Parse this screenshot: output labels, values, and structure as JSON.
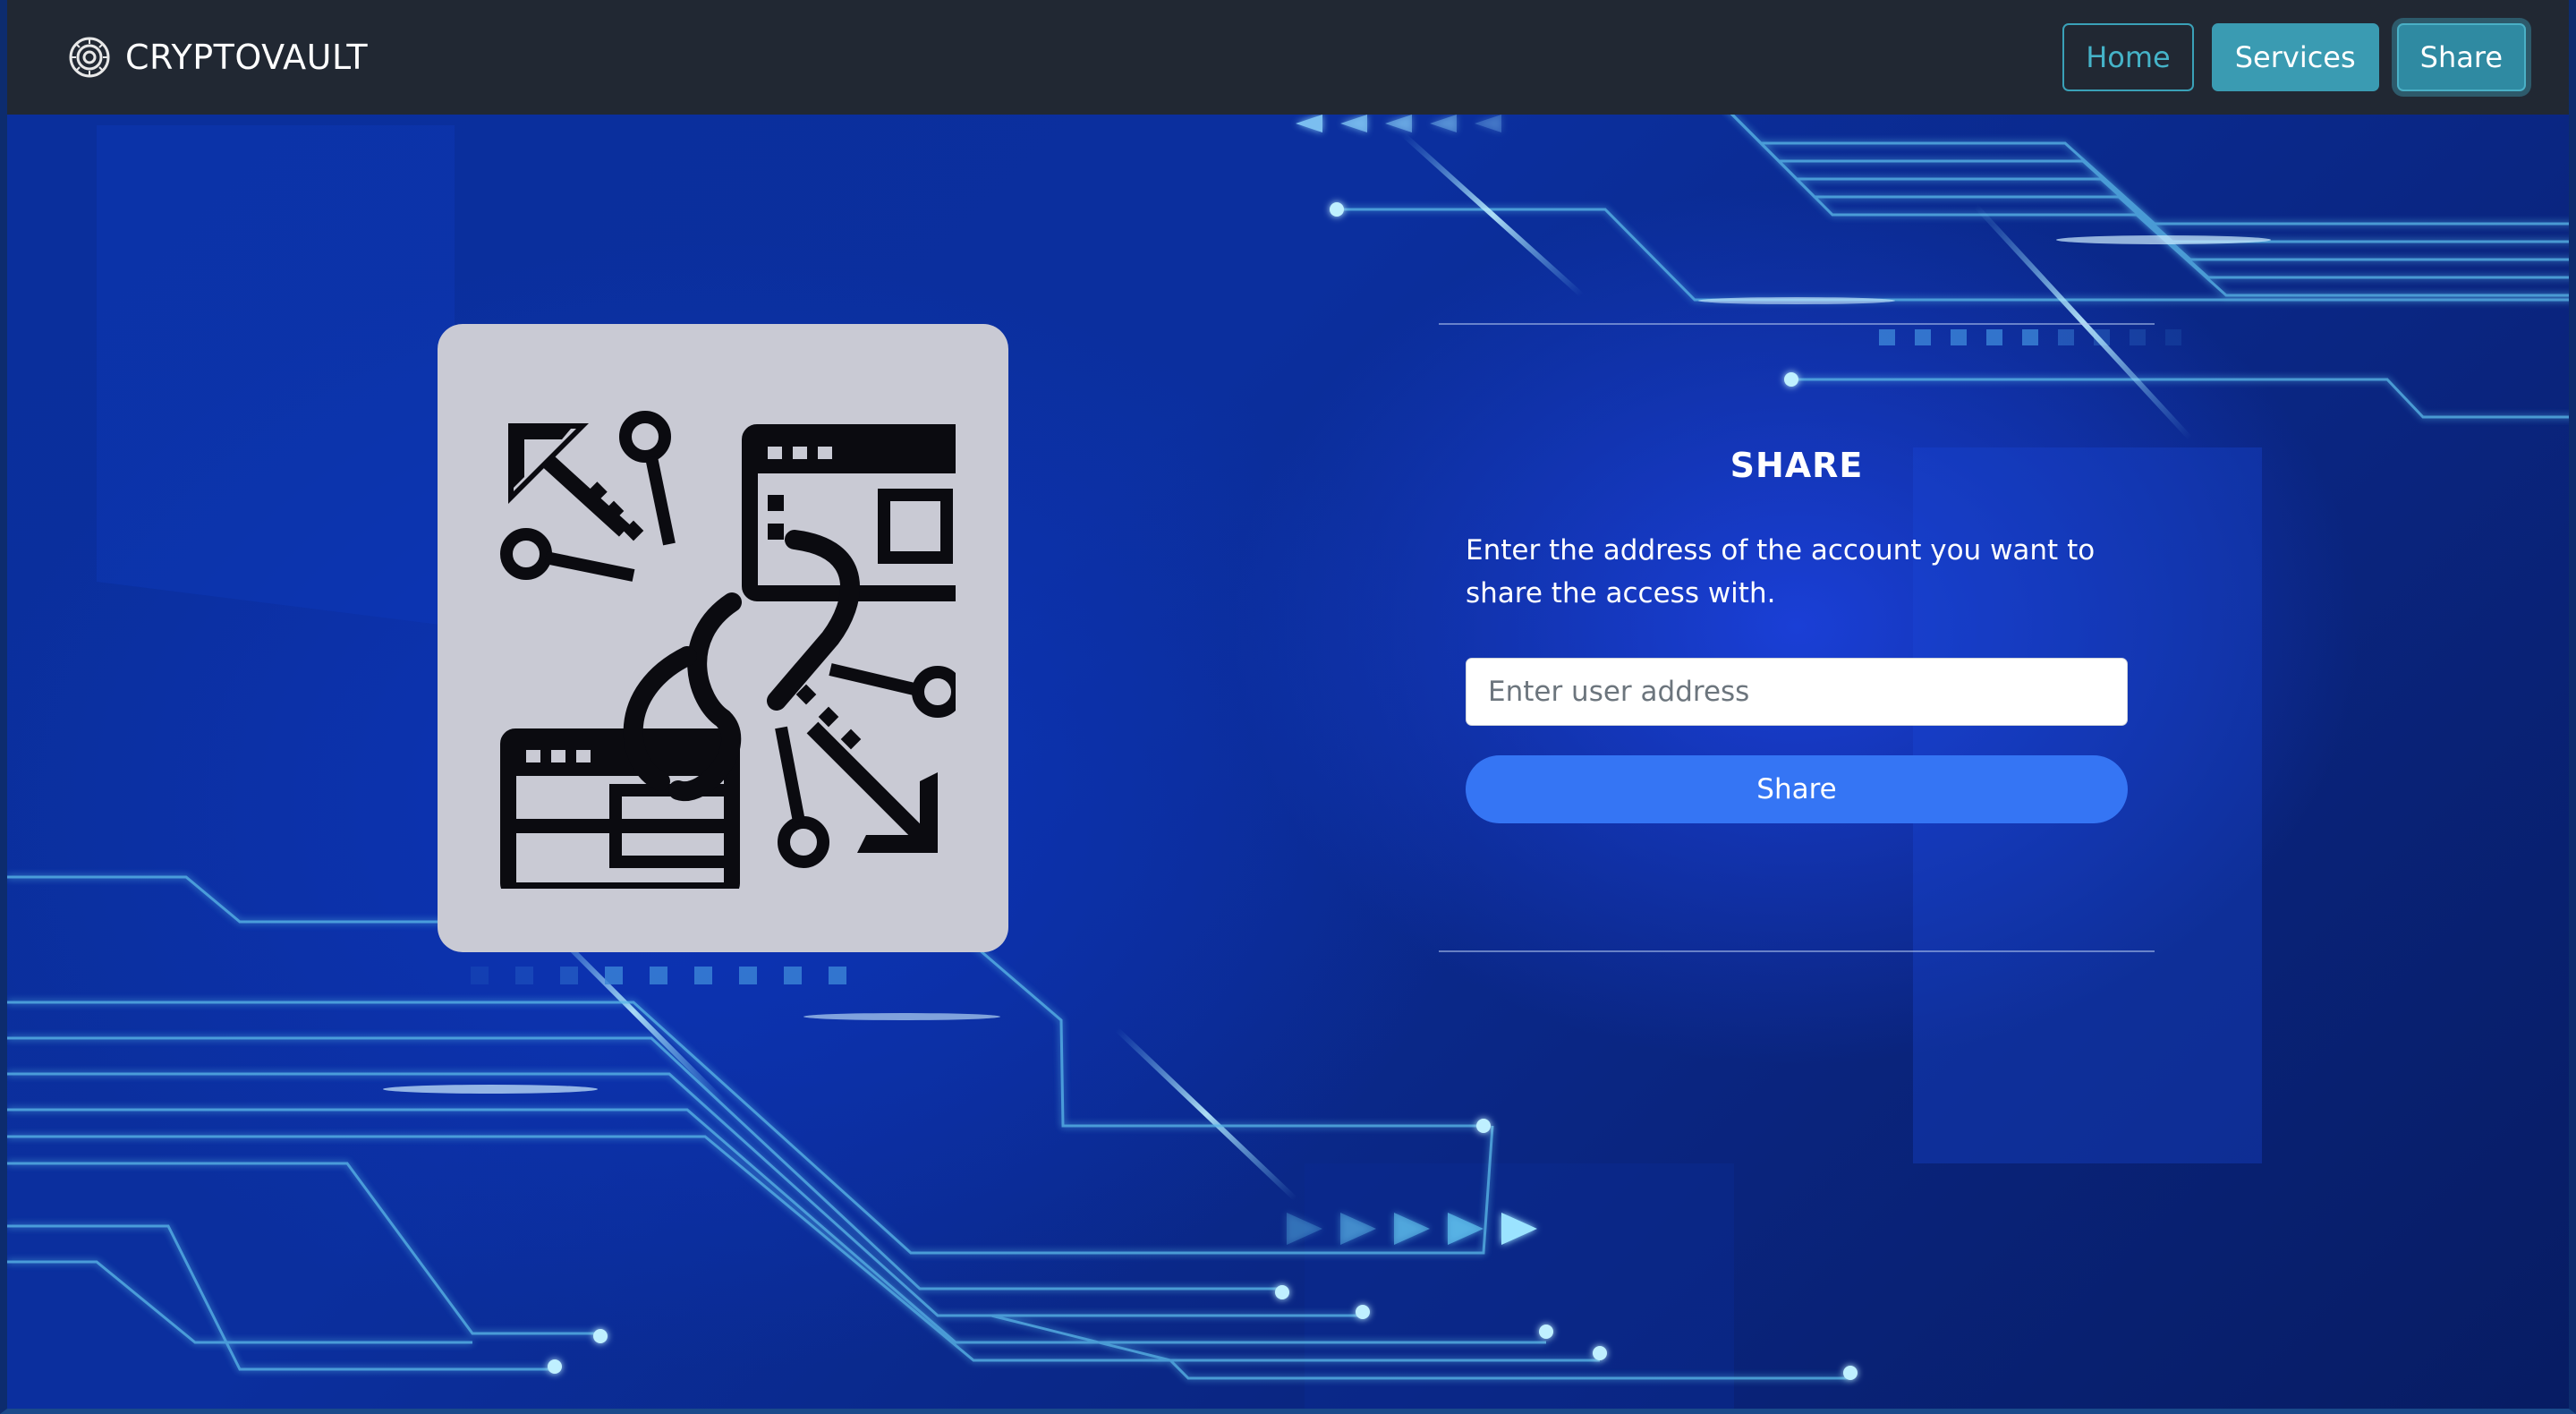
{
  "navbar": {
    "brand": "CRYPTOVAULT",
    "brand_icon": "vault-dial-icon",
    "buttons": [
      {
        "label": "Home",
        "style": "outline"
      },
      {
        "label": "Services",
        "style": "filled"
      },
      {
        "label": "Share",
        "style": "active"
      }
    ]
  },
  "illustration": {
    "icon": "data-sharing-network-icon"
  },
  "share": {
    "title": "SHARE",
    "description": "Enter the address of the account you want to share the access with.",
    "input_placeholder": "Enter user address",
    "input_value": "",
    "button_label": "Share"
  },
  "colors": {
    "navbar_bg": "#212833",
    "accent_teal": "#3a9bb2",
    "primary_button": "#3575f4",
    "background": "#0b2f9e",
    "card_bg": "#c9cad4"
  }
}
